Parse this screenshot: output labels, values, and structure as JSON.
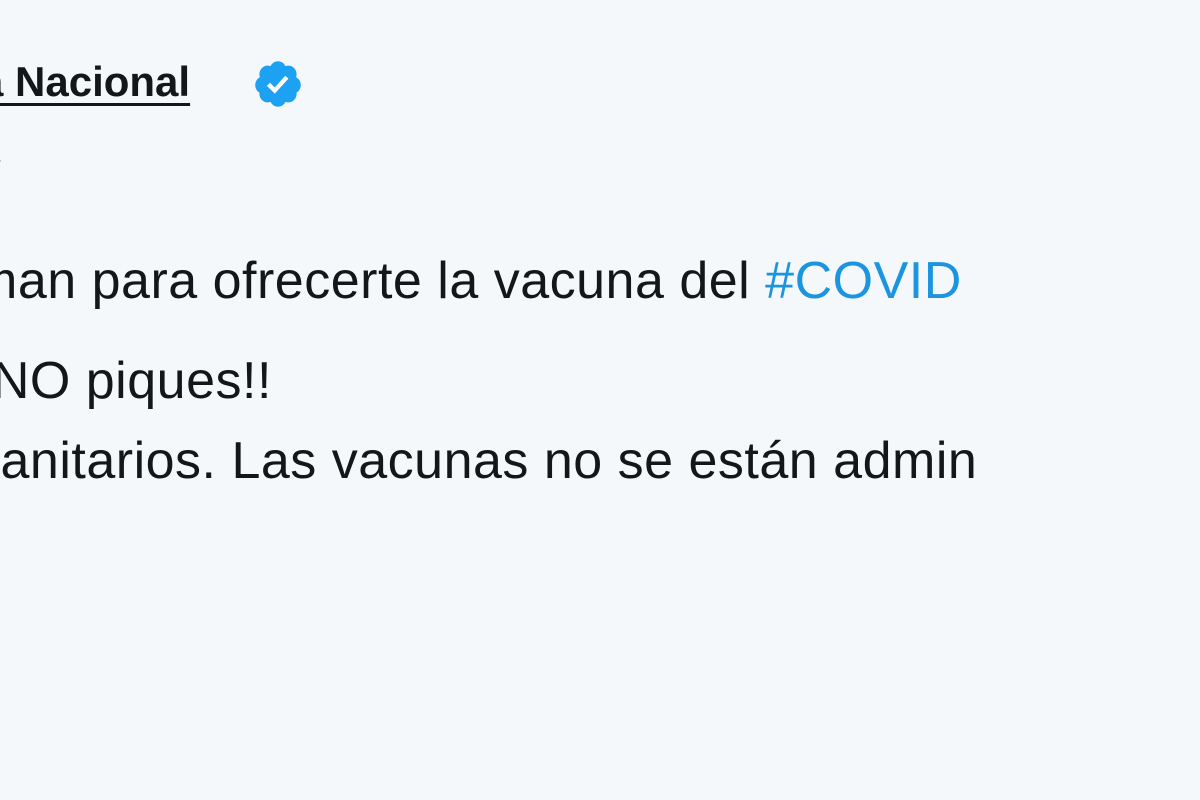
{
  "account": {
    "display_name": "a Nacional",
    "handle": "ía",
    "verified_color": "#1da1f2"
  },
  "tweet": {
    "line1_text": "man para ofrecerte la vacuna del ",
    "line1_hashtag": "#COVID",
    "line2_text": "¡NO piques!!",
    "line3_text": "sanitarios. Las vacunas no se están admin"
  },
  "colors": {
    "text": "#14171a",
    "secondary": "#657786",
    "link": "#1b95e0",
    "background": "#f5f8fa"
  }
}
